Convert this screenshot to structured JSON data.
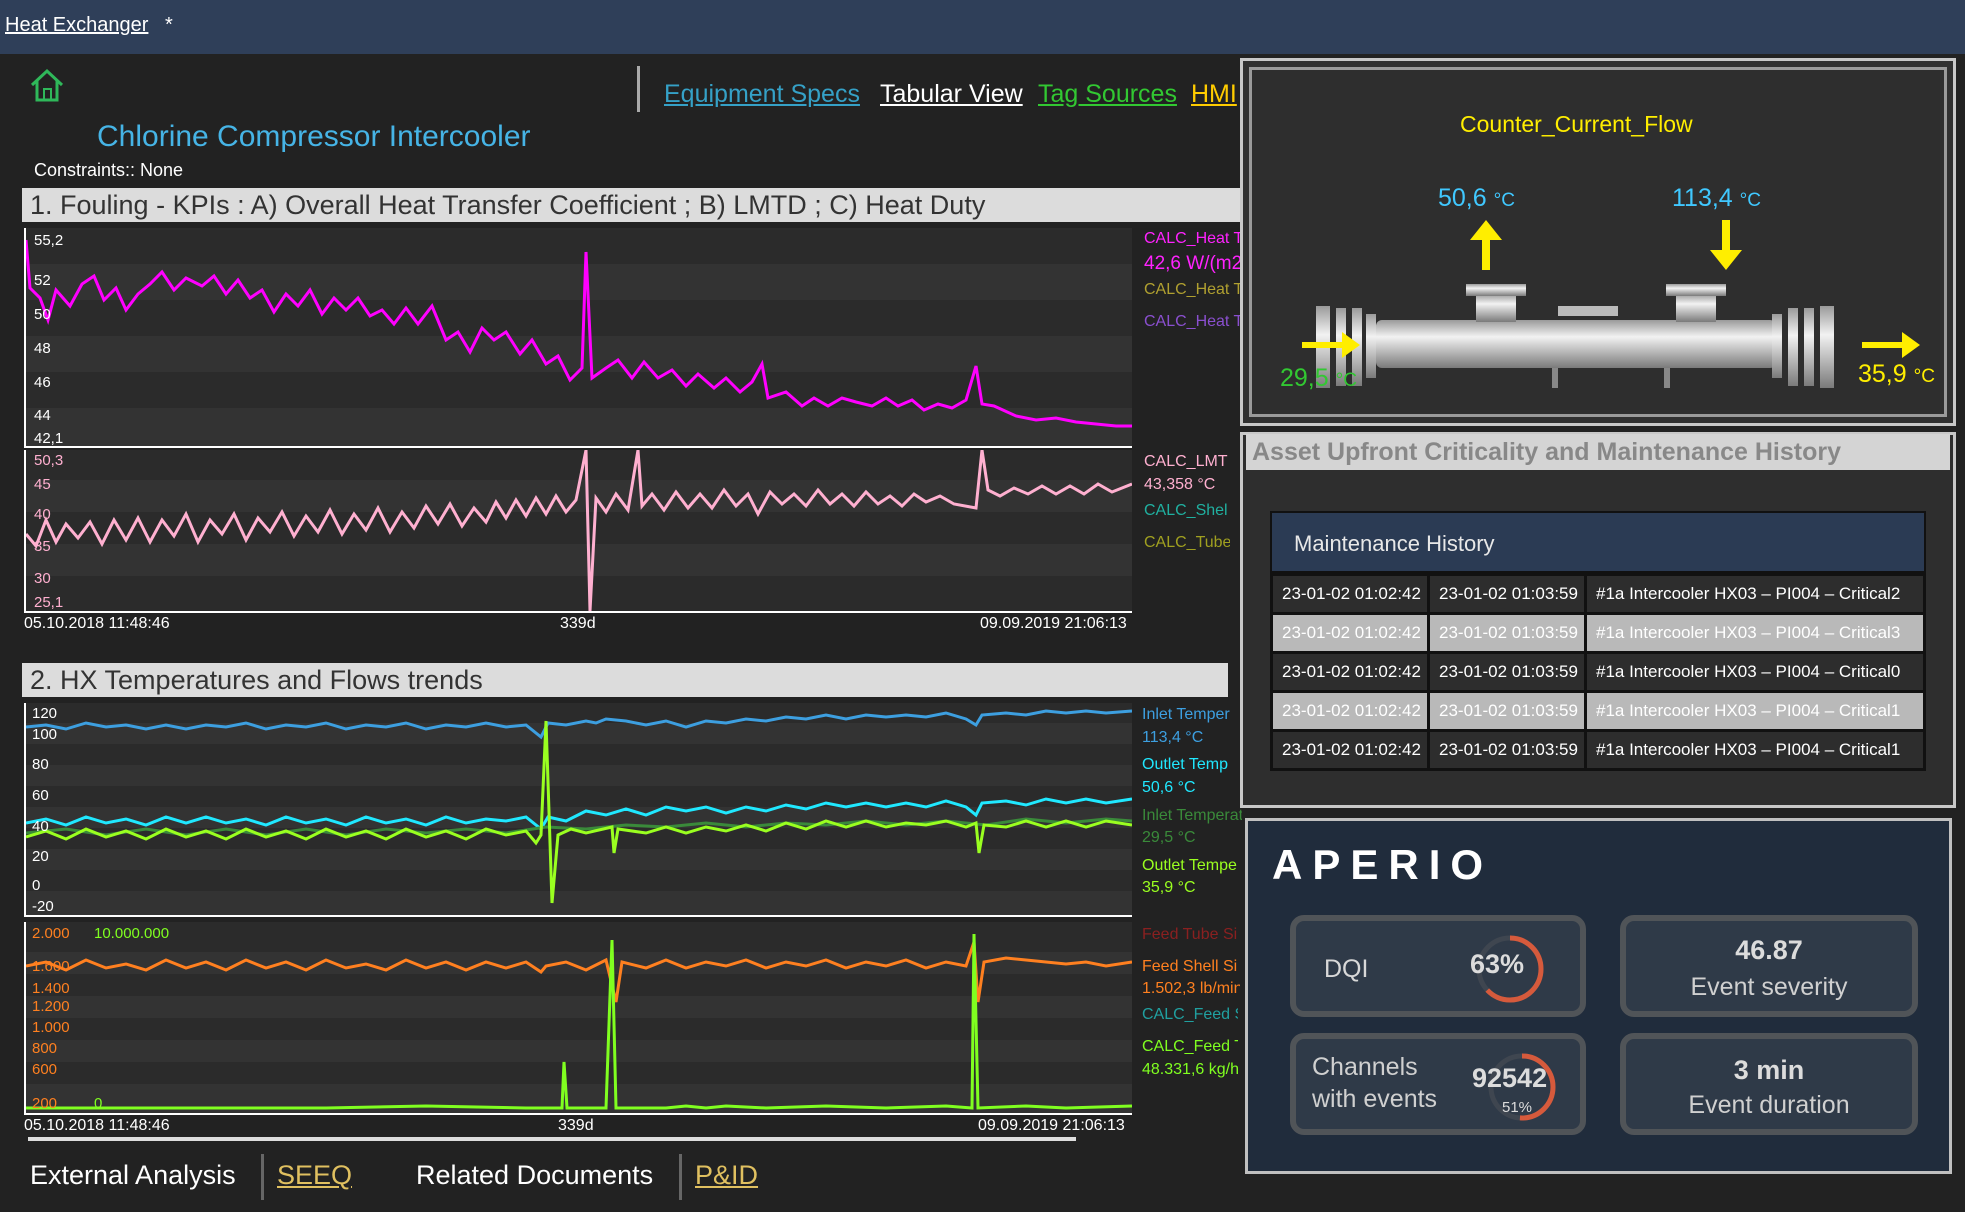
{
  "window": {
    "title": "Heat Exchanger",
    "modified_marker": "*"
  },
  "nav": {
    "home_icon": "home-icon",
    "links": [
      {
        "label": "Equipment Specs",
        "color": "#35a1c7"
      },
      {
        "label": "Tabular View",
        "color": "#ffffff"
      },
      {
        "label": "Tag Sources",
        "color": "#32c832"
      },
      {
        "label": "HMI",
        "color": "#ffcc00"
      }
    ]
  },
  "asset": {
    "name": "Chlorine Compressor Intercooler",
    "constraints": "Constraints:: None"
  },
  "section1": {
    "title": "1. Fouling - KPIs : A) Overall Heat Transfer Coefficient ; B) LMTD ; C) Heat Duty",
    "plot_a": {
      "y_ticks": [
        "55,2",
        "52",
        "50",
        "48",
        "46",
        "44",
        "42,1"
      ],
      "legend": [
        {
          "text": "CALC_Heat T",
          "color": "#ff22ff"
        },
        {
          "text": "42,6 W/(m2",
          "color": "#ff22ff"
        },
        {
          "text": "CALC_Heat T",
          "color": "#b0a030"
        },
        {
          "text": "CALC_Heat T",
          "color": "#8a4fcf"
        }
      ]
    },
    "plot_b": {
      "y_ticks": [
        "50,3",
        "45",
        "40",
        "35",
        "30",
        "25,1"
      ],
      "legend": [
        {
          "text": "CALC_LMT",
          "color": "#ffb0d0"
        },
        {
          "text": "43,358 °C",
          "color": "#ffb0d0"
        },
        {
          "text": "CALC_Shel",
          "color": "#20b0a0"
        },
        {
          "text": "CALC_Tube",
          "color": "#a0a020"
        }
      ]
    },
    "x_axis": {
      "start": "05.10.2018 11:48:46",
      "middle": "339d",
      "end": "09.09.2019 21:06:13"
    }
  },
  "section2": {
    "title": "2. HX Temperatures and Flows trends",
    "plot_c": {
      "y_ticks": [
        "120",
        "100",
        "80",
        "60",
        "40",
        "20",
        "0",
        "-20"
      ],
      "legend": [
        {
          "text": "Inlet Temper",
          "color": "#3d9fe0"
        },
        {
          "text": "113,4 °C",
          "color": "#3d9fe0"
        },
        {
          "text": "Outlet Temp",
          "color": "#20e8ff"
        },
        {
          "text": "50,6 °C",
          "color": "#20e8ff"
        },
        {
          "text": "Inlet Temperature Tube Side Inlet",
          "color": "#3a8a3a"
        },
        {
          "text": "29,5 °C",
          "color": "#3a8a3a"
        },
        {
          "text": "Outlet Tempe",
          "color": "#9aff20"
        },
        {
          "text": "35,9 °C",
          "color": "#9aff20"
        }
      ]
    },
    "plot_d": {
      "y_ticks_left": [
        "2.000",
        "1.600",
        "1.400",
        "1.200",
        "1.000",
        "800",
        "600",
        "200"
      ],
      "y_top_right": "10.000.000",
      "y_bottom_right": "0",
      "legend": [
        {
          "text": "Feed Tube Si",
          "color": "#8a2020"
        },
        {
          "text": "Feed Shell Si",
          "color": "#ff8020"
        },
        {
          "text": "1.502,3 lb/min",
          "color": "#ff8020"
        },
        {
          "text": "CALC_Feed S",
          "color": "#20a0a0"
        },
        {
          "text": "CALC_Feed T",
          "color": "#80ff20"
        },
        {
          "text": "48.331,6 kg/h",
          "color": "#80ff20"
        }
      ]
    },
    "x_axis": {
      "start": "05.10.2018 11:48:46",
      "middle": "339d",
      "end": "09.09.2019 21:06:13"
    }
  },
  "hmi": {
    "title": "Counter_Current_Flow",
    "temps": {
      "tube_out": {
        "value": "50,6",
        "unit": "°C"
      },
      "shell_in": {
        "value": "113,4",
        "unit": "°C"
      },
      "tube_in": {
        "value": "29,5",
        "unit": "°C"
      },
      "shell_out": {
        "value": "35,9",
        "unit": "°C"
      }
    }
  },
  "maintenance": {
    "panel_title": "Asset Upfront Criticality and Maintenance History",
    "table_title": "Maintenance History",
    "rows": [
      {
        "start": "23-01-02 01:02:42",
        "end": "23-01-02 01:03:59",
        "desc": "#1a Intercooler HX03 – PI004 – Critical2"
      },
      {
        "start": "23-01-02 01:02:42",
        "end": "23-01-02 01:03:59",
        "desc": "#1a Intercooler HX03 – PI004 – Critical3"
      },
      {
        "start": "23-01-02 01:02:42",
        "end": "23-01-02 01:03:59",
        "desc": "#1a Intercooler HX03 – PI004 – Critical0"
      },
      {
        "start": "23-01-02 01:02:42",
        "end": "23-01-02 01:03:59",
        "desc": "#1a Intercooler HX03 – PI004 – Critical1"
      },
      {
        "start": "23-01-02 01:02:42",
        "end": "23-01-02 01:03:59",
        "desc": "#1a Intercooler HX03 – PI004 – Critical1"
      }
    ]
  },
  "aperio": {
    "logo": "APERIO",
    "dqi": {
      "label": "DQI",
      "value": "63%",
      "fraction": 0.63
    },
    "channels": {
      "label_line1": "Channels",
      "label_line2": "with events",
      "value": "92542",
      "percent": "51%",
      "fraction": 0.51
    },
    "severity": {
      "value": "46.87",
      "label": "Event severity"
    },
    "duration": {
      "value": "3 min",
      "label": "Event duration"
    }
  },
  "footer": {
    "external_analysis": "External Analysis",
    "seeq": "SEEQ",
    "related_documents": "Related Documents",
    "pid": "P&ID"
  }
}
